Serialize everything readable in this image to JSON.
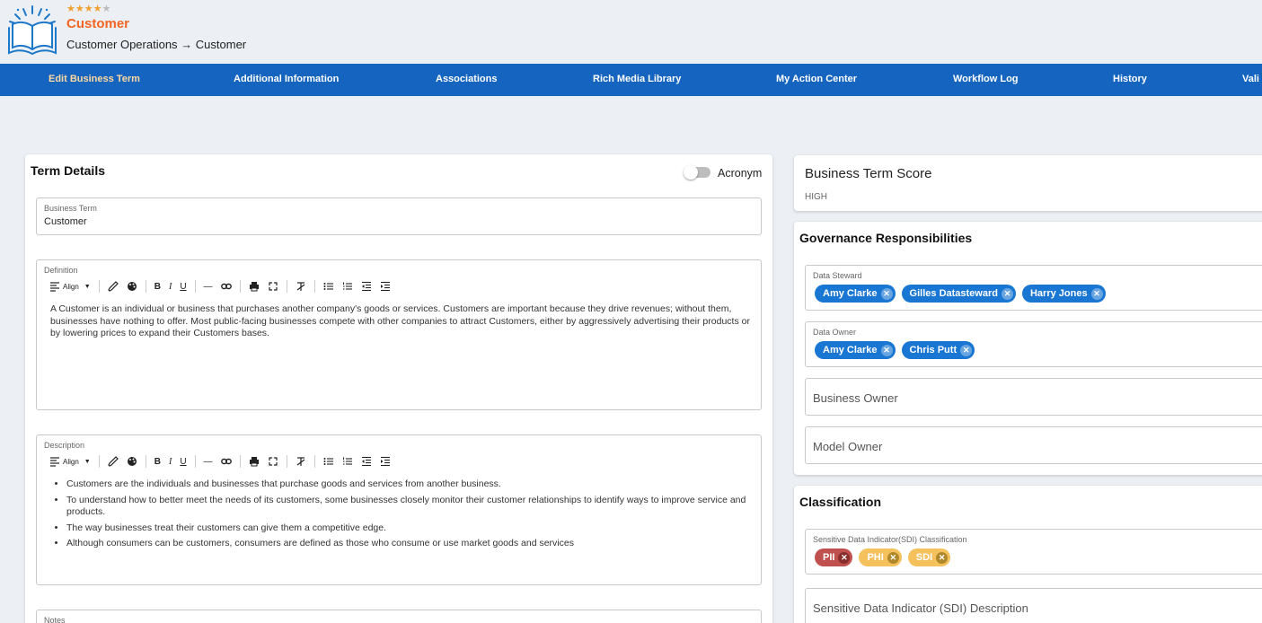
{
  "header": {
    "rating": 4,
    "rating_max": 5,
    "star_color": "#f0a030",
    "entity_name": "Customer",
    "breadcrumb": "Customer Operations → Customer",
    "logo_icon": "open-book-icon"
  },
  "nav": {
    "tabs": [
      {
        "label": "Edit Business Term",
        "active": true
      },
      {
        "label": "Additional Information"
      },
      {
        "label": "Associations"
      },
      {
        "label": "Rich Media Library"
      },
      {
        "label": "My Action Center"
      },
      {
        "label": "Workflow Log"
      },
      {
        "label": "History"
      },
      {
        "label": "Vali"
      }
    ]
  },
  "term_details": {
    "title": "Term Details",
    "acronym_label": "Acronym",
    "acronym_on": false,
    "business_term": {
      "label": "Business Term",
      "value": "Customer"
    },
    "definition": {
      "label": "Definition",
      "align_label": "Align",
      "text": "A Customer is an individual or business that purchases another company's goods or services. Customers are important because they drive revenues; without them, businesses have nothing to offer. Most public-facing businesses compete with other companies to attract Customers, either by aggressively advertising their products or by lowering prices to expand their Customers bases."
    },
    "description": {
      "label": "Description",
      "align_label": "Align",
      "bullets": [
        "Customers are the individuals and businesses that purchase goods and services from another business.",
        "To understand how to better meet the needs of its customers, some businesses closely monitor their customer relationships to identify ways to improve service and products.",
        "The way businesses treat their customers can give them a competitive edge.",
        "Although consumers can be customers, consumers are defined as those who consume or use market goods and services"
      ]
    },
    "notes": {
      "label": "Notes"
    }
  },
  "score": {
    "title": "Business Term Score",
    "value": "HIGH"
  },
  "governance": {
    "title": "Governance Responsibilities",
    "data_steward": {
      "label": "Data Steward",
      "people": [
        "Amy Clarke",
        "Gilles Datasteward",
        "Harry Jones"
      ]
    },
    "data_owner": {
      "label": "Data Owner",
      "people": [
        "Amy Clarke",
        "Chris Putt"
      ]
    },
    "business_owner": {
      "placeholder": "Business Owner"
    },
    "model_owner": {
      "placeholder": "Model Owner"
    }
  },
  "classification": {
    "title": "Classification",
    "sdi_label": "Sensitive Data Indicator(SDI) Classification",
    "tags": [
      {
        "label": "PII",
        "color": "#c0504d"
      },
      {
        "label": "PHI",
        "color": "#f4c15d"
      },
      {
        "label": "SDI",
        "color": "#f4c15d"
      }
    ],
    "sdi_description_placeholder": "Sensitive Data Indicator (SDI) Description"
  },
  "colors": {
    "nav_bg": "#1565c0",
    "chip_blue": "#1976d2",
    "accent_orange": "#f26522"
  }
}
